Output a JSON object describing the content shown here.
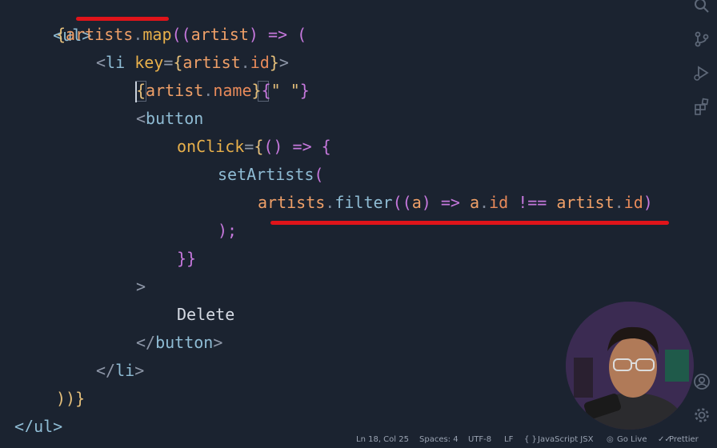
{
  "editor": {
    "line1": {
      "text": "<ul>"
    },
    "line2": {
      "open": "{",
      "artists": "artists",
      "dot": ".",
      "map": "map",
      "paren": "((",
      "artist": "artist",
      "close": ")",
      "arrow": "=>",
      "end": "("
    },
    "line3": {
      "lt": "<",
      "tag": "li",
      "attr": "key",
      "eq": "=",
      "ob": "{",
      "artist": "artist",
      "dot": ".",
      "prop": "id",
      "cb": "}",
      "gt": ">"
    },
    "line4": {
      "ob": "{",
      "artist": "artist",
      "dot": ".",
      "prop": "name",
      "cb": "}",
      "sob": "{",
      "str": "\" \"",
      "scb": "}"
    },
    "line5": {
      "lt": "<",
      "tag": "button"
    },
    "line6": {
      "attr": "onClick",
      "eq": "=",
      "ob": "{",
      "paren": "()",
      "arrow": "=>",
      "brace": "{"
    },
    "line7": {
      "fn": "setArtists",
      "paren": "("
    },
    "line8": {
      "artists": "artists",
      "dot": ".",
      "fn": "filter",
      "paren": "((",
      "a": "a",
      "close": ")",
      "arrow": "=>",
      "a2": "a",
      "dot2": ".",
      "id": "id",
      "op": "!==",
      "artist": "artist",
      "dot3": ".",
      "id2": "id",
      "end": ")"
    },
    "line9": {
      "text": ");"
    },
    "line10": {
      "text": "}}"
    },
    "line11": {
      "text": ">"
    },
    "line12": {
      "text": "Delete"
    },
    "line13": {
      "lt": "</",
      "tag": "button",
      "gt": ">"
    },
    "line14": {
      "lt": "</",
      "tag": "li",
      "gt": ">"
    },
    "line15": {
      "text": "))}"
    },
    "line16": {
      "text": "</ul>"
    }
  },
  "activity_bar": {
    "icons": [
      "search-icon",
      "source-control-icon",
      "run-debug-icon",
      "extensions-icon",
      "account-icon",
      "settings-gear-icon"
    ]
  },
  "statusbar": {
    "position": "Ln 18, Col 25",
    "spaces": "Spaces: 4",
    "encoding": "UTF-8",
    "eol": "LF",
    "language_icon": "{ }",
    "language": "JavaScript JSX",
    "golive": "Go Live",
    "prettier": "Prettier"
  },
  "colors": {
    "background": "#1b2330",
    "annotation_red": "#e0141a",
    "tag": "#8fbcd4",
    "variable": "#f0a068",
    "function": "#e8b04b",
    "keyword": "#c678dd"
  }
}
